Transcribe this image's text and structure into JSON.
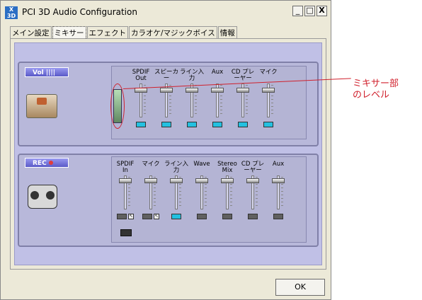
{
  "window": {
    "title": "PCI 3D Audio Configuration",
    "minimize": "_",
    "maximize": "□",
    "close": "X"
  },
  "tabs": [
    {
      "label": "メイン設定",
      "active": false
    },
    {
      "label": "ミキサー",
      "active": true
    },
    {
      "label": "エフェクト",
      "active": false
    },
    {
      "label": "カラオケ/マジックボイス",
      "active": false
    },
    {
      "label": "情報",
      "active": false
    }
  ],
  "playback": {
    "group_label": "Vol",
    "channels": [
      {
        "label": "SPDIF Out",
        "level": 0.85,
        "enabled": true
      },
      {
        "label": "スピーカー",
        "level": 0.85,
        "enabled": true
      },
      {
        "label": "ライン入力",
        "level": 0.85,
        "enabled": true
      },
      {
        "label": "Aux",
        "level": 0.85,
        "enabled": true
      },
      {
        "label": "CD プレーヤー",
        "level": 0.85,
        "enabled": true
      },
      {
        "label": "マイク",
        "level": 0.85,
        "enabled": true
      }
    ]
  },
  "record": {
    "group_label": "REC",
    "channels": [
      {
        "label": "SPDIF In",
        "level": 0.9,
        "enabled": false
      },
      {
        "label": "マイク",
        "level": 0.9,
        "enabled": false
      },
      {
        "label": "ライン入力",
        "level": 0.9,
        "enabled": true
      },
      {
        "label": "Wave",
        "level": 0.9,
        "enabled": false
      },
      {
        "label": "Stereo Mix",
        "level": 0.9,
        "enabled": false
      },
      {
        "label": "CD プレーヤー",
        "level": 0.9,
        "enabled": false
      },
      {
        "label": "Aux",
        "level": 0.9,
        "enabled": false
      }
    ]
  },
  "ok_label": "OK",
  "annotation": {
    "line1": "ミキサー部",
    "line2": "のレベル"
  },
  "colors": {
    "annotation": "#d0202c",
    "panel": "#c0c0e6",
    "active_button": "#23c0e0"
  }
}
